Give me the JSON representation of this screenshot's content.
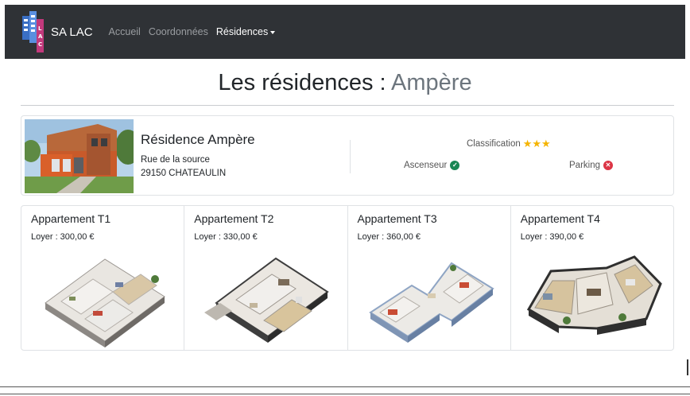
{
  "navbar": {
    "brand": "SA LAC",
    "logo_letters": "LAC",
    "links": [
      {
        "label": "Accueil",
        "active": false
      },
      {
        "label": "Coordonnées",
        "active": false
      },
      {
        "label": "Résidences",
        "active": true,
        "dropdown": true
      }
    ],
    "bg_color": "#2f3236"
  },
  "page": {
    "title_prefix": "Les résidences :",
    "title_name": "Ampère"
  },
  "residence": {
    "name": "Résidence Ampère",
    "street": "Rue de la source",
    "city": "29150 CHATEAULIN",
    "classification_label": "Classification",
    "stars": "★★★",
    "star_count": 3,
    "ascenseur_label": "Ascenseur",
    "ascenseur_available": true,
    "parking_label": "Parking",
    "parking_available": false,
    "ok_icon": "check-circle-icon",
    "no_icon": "x-circle-icon"
  },
  "apartments": [
    {
      "name": "Appartement T1",
      "rent": "Loyer : 300,00 €"
    },
    {
      "name": "Appartement T2",
      "rent": "Loyer : 330,00 €"
    },
    {
      "name": "Appartement T3",
      "rent": "Loyer : 360,00 €"
    },
    {
      "name": "Appartement T4",
      "rent": "Loyer : 390,00 €"
    }
  ],
  "colors": {
    "star": "#f5b400",
    "ok": "#198754",
    "no": "#dc3545",
    "muted": "#6c757d"
  }
}
